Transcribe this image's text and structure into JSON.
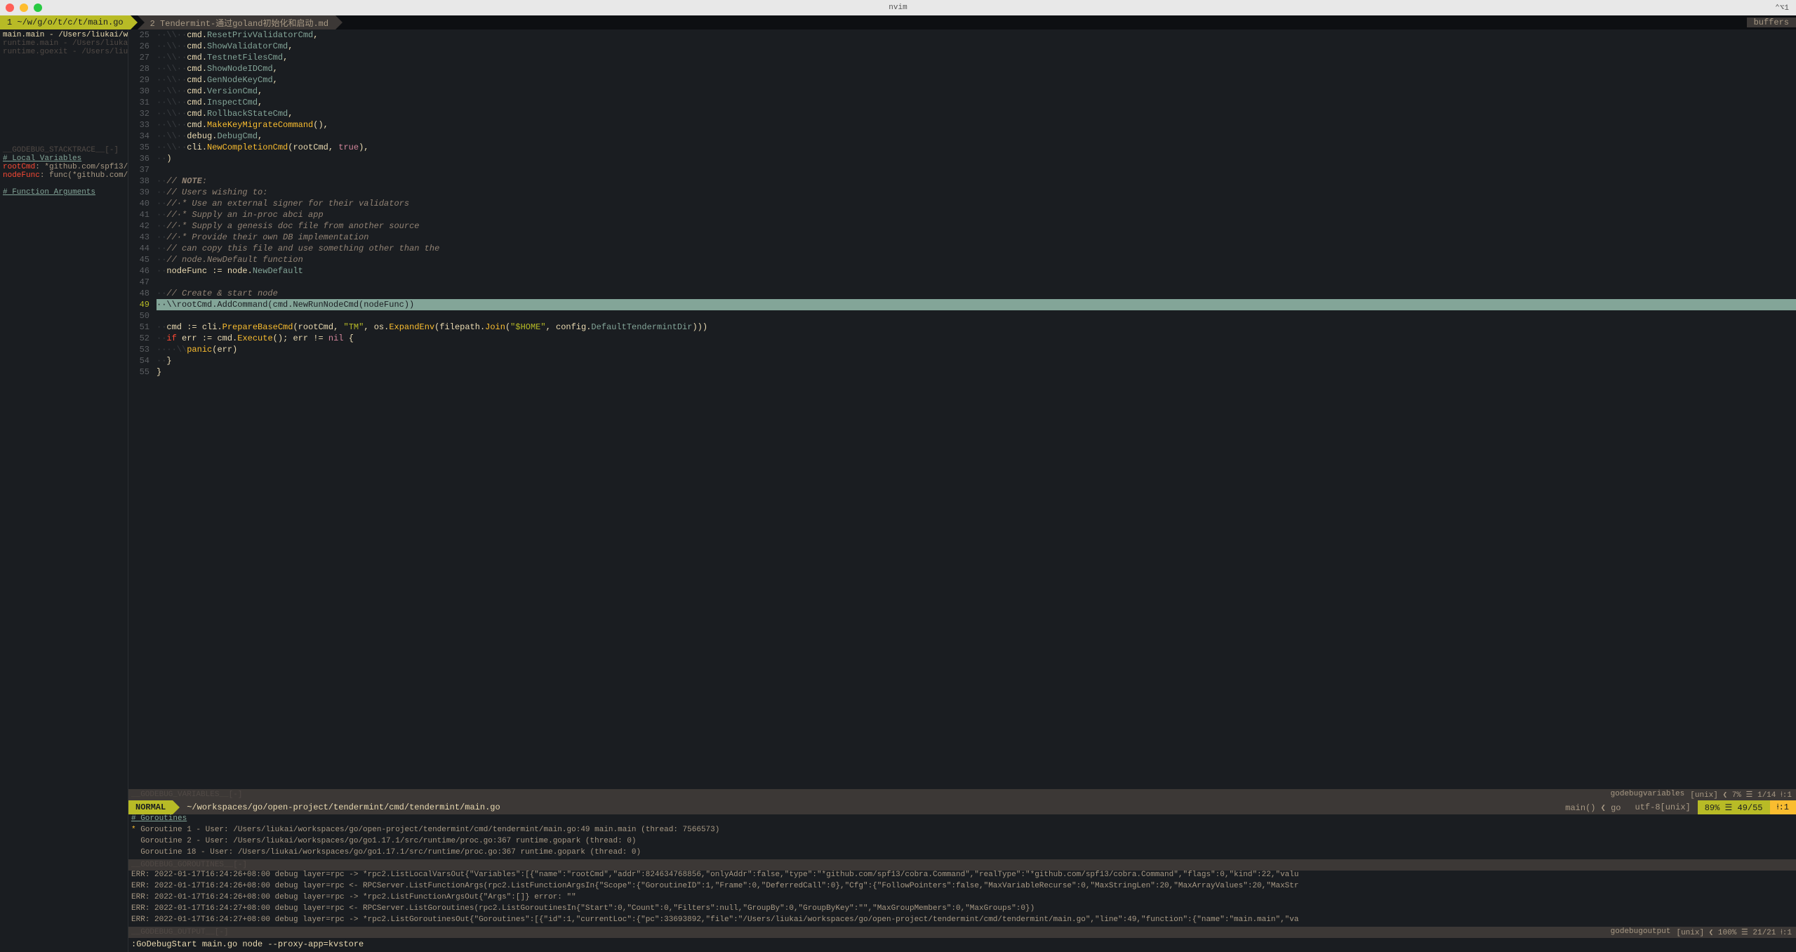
{
  "titlebar": {
    "title": "nvim",
    "right": "⌃⌥1"
  },
  "tabs": {
    "active": "1 ~/w/g/o/t/c/t/main.go",
    "inactive": "2 Tendermint-通过goland初始化和启动.md",
    "buffers": "buffers"
  },
  "sidebar": {
    "stack": [
      {
        "text": "main.main - /Users/liukai/w",
        "active": true
      },
      {
        "text": "runtime.main - /Users/liuka",
        "active": false
      },
      {
        "text": "runtime.goexit - /Users/liu",
        "active": false
      }
    ],
    "stacktrace_header": "__GODEBUG_STACKTRACE__[-]",
    "local_vars_header": "# Local Variables",
    "vars": [
      {
        "name": "rootCmd",
        "val": ": *github.com/spf13/"
      },
      {
        "name": "nodeFunc",
        "val": ": func(*github.com/"
      }
    ],
    "func_args_header": "# Function Arguments"
  },
  "code": {
    "lines": [
      {
        "n": 25,
        "tokens": [
          [
            "ws",
            "··\\\\··"
          ],
          [
            "pkg",
            "cmd"
          ],
          [
            "punct",
            "."
          ],
          [
            "field",
            "ResetPrivValidatorCmd"
          ],
          [
            "punct",
            ","
          ]
        ]
      },
      {
        "n": 26,
        "tokens": [
          [
            "ws",
            "··\\\\··"
          ],
          [
            "pkg",
            "cmd"
          ],
          [
            "punct",
            "."
          ],
          [
            "field",
            "ShowValidatorCmd"
          ],
          [
            "punct",
            ","
          ]
        ]
      },
      {
        "n": 27,
        "tokens": [
          [
            "ws",
            "··\\\\··"
          ],
          [
            "pkg",
            "cmd"
          ],
          [
            "punct",
            "."
          ],
          [
            "field",
            "TestnetFilesCmd"
          ],
          [
            "punct",
            ","
          ]
        ]
      },
      {
        "n": 28,
        "tokens": [
          [
            "ws",
            "··\\\\··"
          ],
          [
            "pkg",
            "cmd"
          ],
          [
            "punct",
            "."
          ],
          [
            "field",
            "ShowNodeIDCmd"
          ],
          [
            "punct",
            ","
          ]
        ]
      },
      {
        "n": 29,
        "tokens": [
          [
            "ws",
            "··\\\\··"
          ],
          [
            "pkg",
            "cmd"
          ],
          [
            "punct",
            "."
          ],
          [
            "field",
            "GenNodeKeyCmd"
          ],
          [
            "punct",
            ","
          ]
        ]
      },
      {
        "n": 30,
        "tokens": [
          [
            "ws",
            "··\\\\··"
          ],
          [
            "pkg",
            "cmd"
          ],
          [
            "punct",
            "."
          ],
          [
            "field",
            "VersionCmd"
          ],
          [
            "punct",
            ","
          ]
        ]
      },
      {
        "n": 31,
        "tokens": [
          [
            "ws",
            "··\\\\··"
          ],
          [
            "pkg",
            "cmd"
          ],
          [
            "punct",
            "."
          ],
          [
            "field",
            "InspectCmd"
          ],
          [
            "punct",
            ","
          ]
        ]
      },
      {
        "n": 32,
        "tokens": [
          [
            "ws",
            "··\\\\··"
          ],
          [
            "pkg",
            "cmd"
          ],
          [
            "punct",
            "."
          ],
          [
            "field",
            "RollbackStateCmd"
          ],
          [
            "punct",
            ","
          ]
        ]
      },
      {
        "n": 33,
        "tokens": [
          [
            "ws",
            "··\\\\··"
          ],
          [
            "pkg",
            "cmd"
          ],
          [
            "punct",
            "."
          ],
          [
            "func",
            "MakeKeyMigrateCommand"
          ],
          [
            "punct",
            "(),"
          ]
        ]
      },
      {
        "n": 34,
        "tokens": [
          [
            "ws",
            "··\\\\··"
          ],
          [
            "pkg",
            "debug"
          ],
          [
            "punct",
            "."
          ],
          [
            "field",
            "DebugCmd"
          ],
          [
            "punct",
            ","
          ]
        ]
      },
      {
        "n": 35,
        "tokens": [
          [
            "ws",
            "··\\\\··"
          ],
          [
            "pkg",
            "cli"
          ],
          [
            "punct",
            "."
          ],
          [
            "func",
            "NewCompletionCmd"
          ],
          [
            "punct",
            "("
          ],
          [
            "ident",
            "rootCmd"
          ],
          [
            "punct",
            ", "
          ],
          [
            "bool",
            "true"
          ],
          [
            "punct",
            "),"
          ]
        ]
      },
      {
        "n": 36,
        "tokens": [
          [
            "ws",
            "··"
          ],
          [
            "punct",
            ")"
          ]
        ]
      },
      {
        "n": 37,
        "tokens": []
      },
      {
        "n": 38,
        "tokens": [
          [
            "ws",
            "··"
          ],
          [
            "comment",
            "// "
          ],
          [
            "commentb",
            "NOTE"
          ],
          [
            "comment",
            ":"
          ]
        ]
      },
      {
        "n": 39,
        "tokens": [
          [
            "ws",
            "··"
          ],
          [
            "comment",
            "// Users wishing to:"
          ]
        ]
      },
      {
        "n": 40,
        "tokens": [
          [
            "ws",
            "··"
          ],
          [
            "comment",
            "//·* Use an external signer for their validators"
          ]
        ]
      },
      {
        "n": 41,
        "tokens": [
          [
            "ws",
            "··"
          ],
          [
            "comment",
            "//·* Supply an in-proc abci app"
          ]
        ]
      },
      {
        "n": 42,
        "tokens": [
          [
            "ws",
            "··"
          ],
          [
            "comment",
            "//·* Supply a genesis doc file from another source"
          ]
        ]
      },
      {
        "n": 43,
        "tokens": [
          [
            "ws",
            "··"
          ],
          [
            "comment",
            "//·* Provide their own DB implementation"
          ]
        ]
      },
      {
        "n": 44,
        "tokens": [
          [
            "ws",
            "··"
          ],
          [
            "comment",
            "// can copy this file and use something other than the"
          ]
        ]
      },
      {
        "n": 45,
        "tokens": [
          [
            "ws",
            "··"
          ],
          [
            "comment",
            "// node.NewDefault function"
          ]
        ]
      },
      {
        "n": 46,
        "tokens": [
          [
            "ws",
            "··"
          ],
          [
            "ident",
            "nodeFunc"
          ],
          [
            "punct",
            " := "
          ],
          [
            "pkg",
            "node"
          ],
          [
            "punct",
            "."
          ],
          [
            "field",
            "NewDefault"
          ]
        ]
      },
      {
        "n": 47,
        "tokens": []
      },
      {
        "n": 48,
        "tokens": [
          [
            "ws",
            "··"
          ],
          [
            "comment",
            "// Create & start node"
          ]
        ]
      },
      {
        "n": 49,
        "hl": true,
        "text": "··\\\\rootCmd.AddCommand(cmd.NewRunNodeCmd(nodeFunc))"
      },
      {
        "n": 50,
        "tokens": []
      },
      {
        "n": 51,
        "tokens": [
          [
            "ws",
            "··"
          ],
          [
            "ident",
            "cmd"
          ],
          [
            "punct",
            " := "
          ],
          [
            "pkg",
            "cli"
          ],
          [
            "punct",
            "."
          ],
          [
            "func",
            "PrepareBaseCmd"
          ],
          [
            "punct",
            "("
          ],
          [
            "ident",
            "rootCmd"
          ],
          [
            "punct",
            ", "
          ],
          [
            "string",
            "\"TM\""
          ],
          [
            "punct",
            ", "
          ],
          [
            "pkg",
            "os"
          ],
          [
            "punct",
            "."
          ],
          [
            "func",
            "ExpandEnv"
          ],
          [
            "punct",
            "("
          ],
          [
            "pkg",
            "filepath"
          ],
          [
            "punct",
            "."
          ],
          [
            "func",
            "Join"
          ],
          [
            "punct",
            "("
          ],
          [
            "string",
            "\"$HOME\""
          ],
          [
            "punct",
            ", "
          ],
          [
            "pkg",
            "config"
          ],
          [
            "punct",
            "."
          ],
          [
            "field",
            "DefaultTendermintDir"
          ],
          [
            "punct",
            ")))"
          ]
        ]
      },
      {
        "n": 52,
        "tokens": [
          [
            "ws",
            "··"
          ],
          [
            "keyword",
            "if"
          ],
          [
            "ident",
            " err "
          ],
          [
            "punct",
            ":= "
          ],
          [
            "ident",
            "cmd"
          ],
          [
            "punct",
            "."
          ],
          [
            "func",
            "Execute"
          ],
          [
            "punct",
            "(); "
          ],
          [
            "ident",
            "err"
          ],
          [
            "punct",
            " != "
          ],
          [
            "bool",
            "nil"
          ],
          [
            "punct",
            " {"
          ]
        ]
      },
      {
        "n": 53,
        "tokens": [
          [
            "ws",
            "····\\\\"
          ],
          [
            "func",
            "panic"
          ],
          [
            "punct",
            "("
          ],
          [
            "ident",
            "err"
          ],
          [
            "punct",
            ")"
          ]
        ]
      },
      {
        "n": 54,
        "tokens": [
          [
            "ws",
            "··"
          ],
          [
            "punct",
            "}"
          ]
        ]
      },
      {
        "n": 55,
        "tokens": [
          [
            "punct",
            "}"
          ]
        ]
      }
    ]
  },
  "statusline": {
    "mode": "NORMAL",
    "path": "~/workspaces/go/open-project/tendermint/cmd/tendermint/main.go",
    "func": "main() ❮ go",
    "encoding": "utf-8[unix]",
    "percent": "89% ☰ 49/55",
    "col": "⍿:1"
  },
  "debug_vars": {
    "header": "__GODEBUG_VARIABLES__[-]",
    "right_name": "godebugvariables",
    "right_info": "[unix] ❮  7% ☰  1/14 ⍿:1"
  },
  "goroutines": {
    "header": "# Goroutines",
    "lines": [
      "* Goroutine 1 - User: /Users/liukai/workspaces/go/open-project/tendermint/cmd/tendermint/main.go:49 main.main (thread: 7566573)",
      "  Goroutine 2 - User: /Users/liukai/workspaces/go/go1.17.1/src/runtime/proc.go:367 runtime.gopark (thread: 0)",
      "  Goroutine 18 - User: /Users/liukai/workspaces/go/go1.17.1/src/runtime/proc.go:367 runtime.gopark (thread: 0)"
    ],
    "footer": "__GODEBUG_GOROUTINES__[-]"
  },
  "output": {
    "lines": [
      "ERR: 2022-01-17T16:24:26+08:00 debug layer=rpc -> *rpc2.ListLocalVarsOut{\"Variables\":[{\"name\":\"rootCmd\",\"addr\":824634768856,\"onlyAddr\":false,\"type\":\"*github.com/spf13/cobra.Command\",\"realType\":\"*github.com/spf13/cobra.Command\",\"flags\":0,\"kind\":22,\"valu",
      "ERR: 2022-01-17T16:24:26+08:00 debug layer=rpc <- RPCServer.ListFunctionArgs(rpc2.ListFunctionArgsIn{\"Scope\":{\"GoroutineID\":1,\"Frame\":0,\"DeferredCall\":0},\"Cfg\":{\"FollowPointers\":false,\"MaxVariableRecurse\":0,\"MaxStringLen\":20,\"MaxArrayValues\":20,\"MaxStr",
      "ERR: 2022-01-17T16:24:26+08:00 debug layer=rpc -> *rpc2.ListFunctionArgsOut{\"Args\":[]} error: \"\"",
      "ERR: 2022-01-17T16:24:27+08:00 debug layer=rpc <- RPCServer.ListGoroutines(rpc2.ListGoroutinesIn{\"Start\":0,\"Count\":0,\"Filters\":null,\"GroupBy\":0,\"GroupByKey\":\"\",\"MaxGroupMembers\":0,\"MaxGroups\":0})",
      "ERR: 2022-01-17T16:24:27+08:00 debug layer=rpc -> *rpc2.ListGoroutinesOut{\"Goroutines\":[{\"id\":1,\"currentLoc\":{\"pc\":33693892,\"file\":\"/Users/liukai/workspaces/go/open-project/tendermint/cmd/tendermint/main.go\",\"line\":49,\"function\":{\"name\":\"main.main\",\"va"
    ],
    "footer": "__GODEBUG_OUTPUT__[-]",
    "right_name": "godebugoutput",
    "right_info": "[unix] ❮ 100% ☰ 21/21 ⍿:1"
  },
  "cmdline": ":GoDebugStart main.go node --proxy-app=kvstore"
}
